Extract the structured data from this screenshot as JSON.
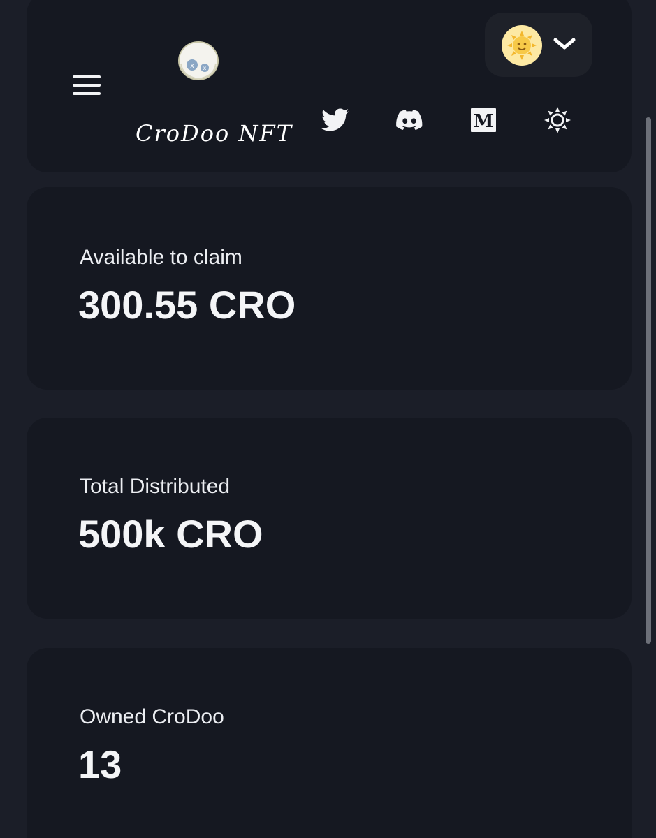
{
  "header": {
    "brand_name": "CroDoo NFT",
    "icons": {
      "menu": "hamburger-menu-icon",
      "logo": "crodoo-mascot-logo",
      "twitter": "twitter-icon",
      "discord": "discord-icon",
      "medium": "medium-icon",
      "theme": "sun-icon",
      "avatar": "sun-face-avatar",
      "dropdown": "chevron-down-icon"
    }
  },
  "stats": [
    {
      "label": "Available to claim",
      "value": "300.55 CRO"
    },
    {
      "label": "Total Distributed",
      "value": "500k CRO"
    },
    {
      "label": "Owned CroDoo",
      "value": "13"
    }
  ],
  "colors": {
    "background": "#1b1e28",
    "card": "#151821",
    "text": "#f2f3f5",
    "avatar": "#fde9a3"
  }
}
